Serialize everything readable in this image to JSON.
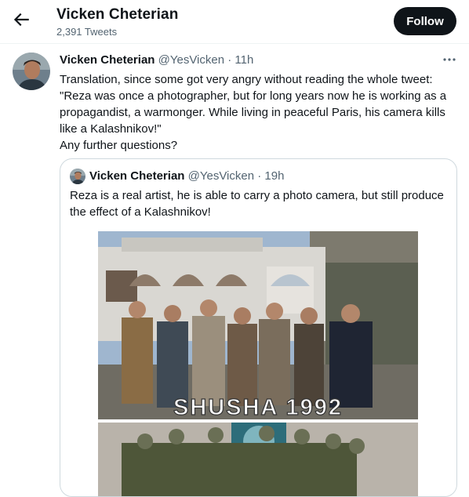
{
  "header": {
    "title": "Vicken Cheterian",
    "tweet_count": "2,391 Tweets",
    "follow_label": "Follow"
  },
  "tweet": {
    "author_name": "Vicken Cheterian",
    "handle": "@YesVicken",
    "separator": " · ",
    "time": "11h",
    "lines": [
      "Translation, since some got very angry without reading the whole tweet:",
      "\"Reza was once a photographer, but for long years now he is working as a",
      "propagandist, a warmonger. While living in peaceful Paris, his camera kills",
      "like a Kalashnikov!\"",
      "Any further questions?"
    ]
  },
  "quoted_tweet": {
    "author_name": "Vicken Cheterian",
    "handle": "@YesVicken",
    "separator": " · ",
    "time": "19h",
    "lines": [
      "Reza is a real artist, he is able to carry a photo camera, but still produce",
      "the effect of a Kalashnikov!"
    ],
    "image": {
      "caption": "SHUSHA 1992"
    }
  },
  "colors": {
    "text": "#0f1419",
    "secondary": "#536471",
    "border": "#cfd9de",
    "follow_bg": "#0f1419"
  },
  "icons": [
    "back-arrow-icon",
    "more-options-icon"
  ]
}
